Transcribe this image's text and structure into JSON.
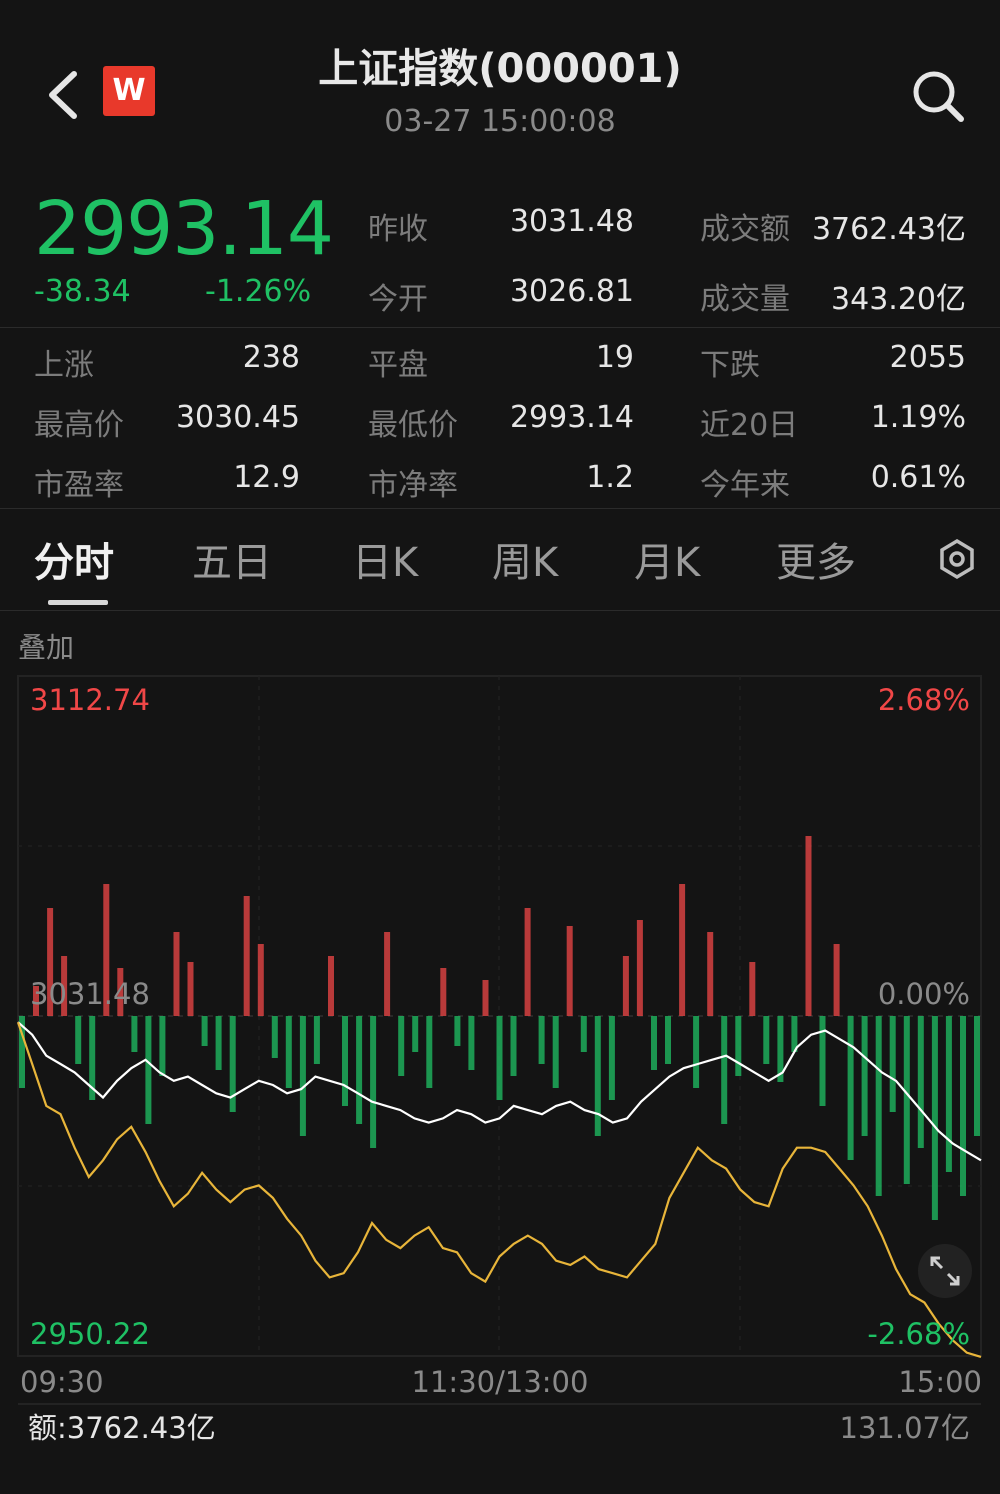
{
  "header": {
    "logo_letter": "W",
    "title": "上证指数(000001)",
    "datetime": "03-27 15:00:08"
  },
  "quote": {
    "price": "2993.14",
    "change": "-38.34",
    "change_pct": "-1.26%",
    "prev_close_label": "昨收",
    "prev_close": "3031.48",
    "open_label": "今开",
    "open": "3026.81",
    "turnover_label": "成交额",
    "turnover": "3762.43亿",
    "volume_label": "成交量",
    "volume": "343.20亿",
    "up_label": "上涨",
    "up": "238",
    "flat_label": "平盘",
    "flat": "19",
    "down_label": "下跌",
    "down": "2055",
    "high_label": "最高价",
    "high": "3030.45",
    "low_label": "最低价",
    "low": "2993.14",
    "d20_label": "近20日",
    "d20": "1.19%",
    "pe_label": "市盈率",
    "pe": "12.9",
    "pb_label": "市净率",
    "pb": "1.2",
    "ytd_label": "今年来",
    "ytd": "0.61%"
  },
  "tabs": [
    "分时",
    "五日",
    "日K",
    "周K",
    "月K",
    "更多"
  ],
  "active_tab": "分时",
  "overlay_label": "叠加",
  "colors": {
    "up": "#f04747",
    "down": "#1fc164",
    "index_line": "#ffffff",
    "avg_line": "#e8b53a",
    "background": "#141414"
  },
  "chart_data": {
    "type": "line",
    "y_max": "3112.74",
    "y_mid": "3031.48",
    "y_min": "2950.22",
    "pct_max": "2.68%",
    "pct_mid": "0.00%",
    "pct_min": "-2.68%",
    "ylim": [
      2950.22,
      3112.74
    ],
    "x_labels": [
      "09:30",
      "11:30/13:00",
      "15:00"
    ],
    "turnover_label": "额:3762.43亿",
    "turnover_max": "131.07亿",
    "series": [
      {
        "color": "#ffffff",
        "values": [
          3030,
          3027,
          3022,
          3020,
          3018,
          3015,
          3012,
          3016,
          3019,
          3021,
          3018,
          3016,
          3017,
          3015,
          3013,
          3012,
          3014,
          3016,
          3015,
          3013,
          3014,
          3017,
          3016,
          3015,
          3013,
          3011,
          3010,
          3009,
          3007,
          3006,
          3007,
          3009,
          3008,
          3006,
          3007,
          3010,
          3009,
          3008,
          3010,
          3011,
          3009,
          3008,
          3006,
          3007,
          3011,
          3014,
          3017,
          3019,
          3020,
          3021,
          3022,
          3020,
          3018,
          3016,
          3018,
          3024,
          3027,
          3028,
          3026,
          3024,
          3021,
          3018,
          3016,
          3012,
          3008,
          3004,
          3001,
          2999,
          2997
        ]
      },
      {
        "color": "#e8b53a",
        "values": [
          3030,
          3020,
          3010,
          3008,
          3000,
          2993,
          2997,
          3002,
          3005,
          2999,
          2992,
          2986,
          2989,
          2994,
          2990,
          2987,
          2990,
          2991,
          2988,
          2983,
          2979,
          2973,
          2969,
          2970,
          2975,
          2982,
          2978,
          2976,
          2979,
          2981,
          2976,
          2975,
          2970,
          2968,
          2974,
          2977,
          2979,
          2977,
          2973,
          2972,
          2974,
          2971,
          2970,
          2969,
          2973,
          2977,
          2988,
          2994,
          3000,
          2997,
          2995,
          2990,
          2987,
          2986,
          2995,
          3000,
          3000,
          2999,
          2995,
          2991,
          2986,
          2979,
          2971,
          2965,
          2963,
          2958,
          2954,
          2951,
          2950
        ]
      }
    ],
    "volume_bars": [
      -12,
      5,
      18,
      10,
      -8,
      -14,
      22,
      8,
      -6,
      -18,
      -10,
      14,
      9,
      -5,
      -9,
      -16,
      20,
      12,
      -7,
      -12,
      -20,
      -8,
      10,
      -15,
      -18,
      -22,
      14,
      -10,
      -6,
      -12,
      8,
      -5,
      -9,
      6,
      -14,
      -10,
      18,
      -8,
      -12,
      15,
      -6,
      -20,
      -14,
      10,
      16,
      -9,
      -8,
      22,
      -12,
      14,
      -18,
      -10,
      9,
      -8,
      -11,
      -6,
      30,
      -15,
      12,
      -24,
      -20,
      -30,
      -16,
      -28,
      -22,
      -34,
      -26,
      -30,
      -20
    ]
  }
}
